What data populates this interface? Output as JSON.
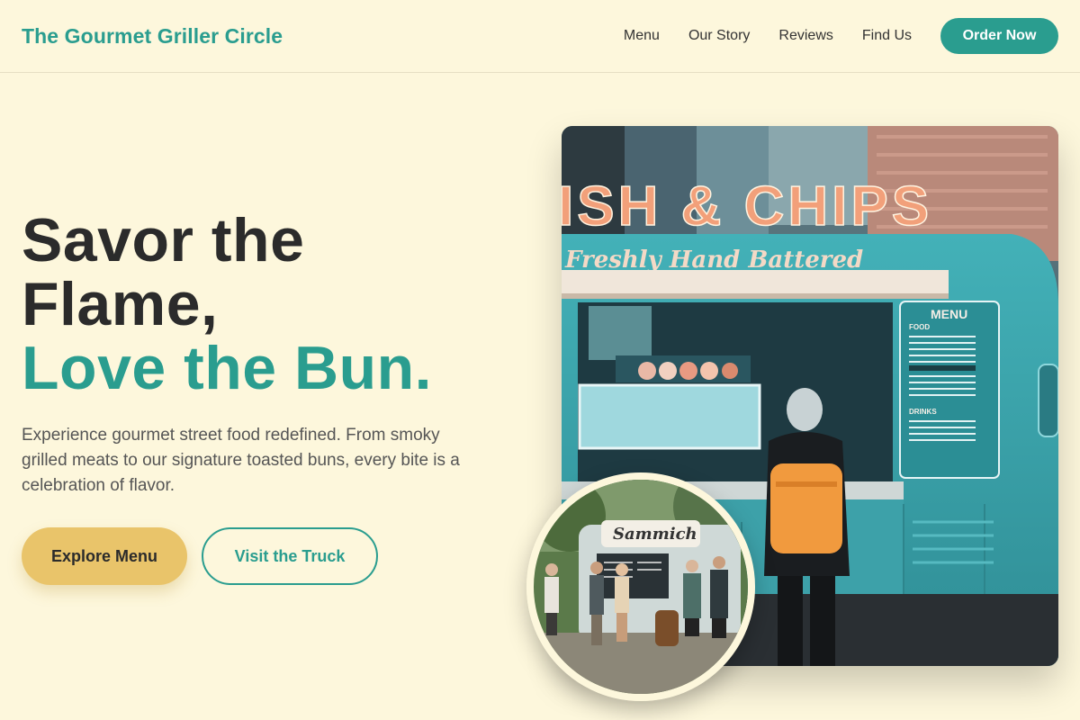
{
  "header": {
    "logo": "The Gourmet Griller Circle",
    "nav": [
      "Menu",
      "Our Story",
      "Reviews",
      "Find Us"
    ],
    "cta": "Order Now"
  },
  "hero": {
    "title_line1": "Savor the",
    "title_line2": "Flame,",
    "title_accent": "Love the Bun.",
    "description": "Experience gourmet street food redefined. From smoky grilled meats to our signature toasted buns, every bite is a celebration of flavor.",
    "primary_button": "Explore Menu",
    "secondary_button": "Visit the Truck"
  },
  "images": {
    "main": {
      "sign": "ISH & CHIPS",
      "script": "Freshly Hand Battered",
      "menu_title": "MENU",
      "menu_food": "FOOD",
      "menu_drinks": "DRINKS"
    },
    "circle": {
      "sign": "Sammich"
    }
  },
  "colors": {
    "accent": "#2a9d8f",
    "gold": "#e9c46a",
    "background": "#fdf7dc"
  }
}
